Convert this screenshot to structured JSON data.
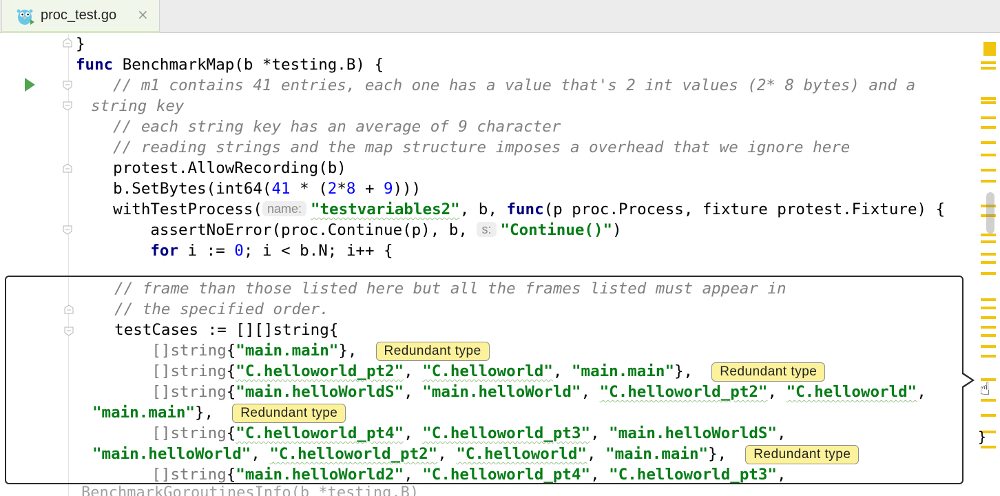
{
  "tab": {
    "title": "proc_test.go",
    "icon": "gopher-file-icon",
    "close": "×"
  },
  "editor": {
    "lines": [
      {
        "id": "l0",
        "segments": [
          {
            "t": "}",
            "c": ""
          }
        ]
      },
      {
        "id": "l1",
        "segments": [
          {
            "t": "func",
            "c": "kw"
          },
          {
            "t": " BenchmarkMap(b *testing.B) {",
            "c": ""
          }
        ]
      },
      {
        "id": "l2",
        "segments": [
          {
            "t": "    // m1 contains 41 entries, each one has a value that's 2 int values (2* 8 bytes) and a",
            "c": "cm"
          }
        ]
      },
      {
        "id": "l3",
        "segments": [
          {
            "t": "string key",
            "c": "cm"
          }
        ]
      },
      {
        "id": "l4",
        "segments": [
          {
            "t": "    // each string key has an average of 9 character",
            "c": "cm"
          }
        ]
      },
      {
        "id": "l5",
        "segments": [
          {
            "t": "    // reading strings and the map structure imposes a overhead that we ignore here",
            "c": "cm"
          }
        ]
      },
      {
        "id": "l6",
        "segments": [
          {
            "t": "    protest.AllowRecording(b)",
            "c": ""
          }
        ]
      },
      {
        "id": "l7",
        "segments": [
          {
            "t": "    b.SetBytes(int64(",
            "c": ""
          },
          {
            "t": "41",
            "c": "num"
          },
          {
            "t": " * (",
            "c": ""
          },
          {
            "t": "2",
            "c": "num"
          },
          {
            "t": "*",
            "c": ""
          },
          {
            "t": "8",
            "c": "num"
          },
          {
            "t": " + ",
            "c": ""
          },
          {
            "t": "9",
            "c": "num"
          },
          {
            "t": ")))",
            "c": ""
          }
        ]
      },
      {
        "id": "l8",
        "segments": [
          {
            "t": "    withTestProcess(",
            "c": ""
          },
          {
            "t": "name:",
            "c": "hint"
          },
          {
            "t": "\"testvariables2\"",
            "c": "str wavy"
          },
          {
            "t": ", b, ",
            "c": ""
          },
          {
            "t": "func",
            "c": "kw"
          },
          {
            "t": "(p proc.Process, fixture protest.Fixture) {",
            "c": ""
          }
        ]
      },
      {
        "id": "l9",
        "segments": [
          {
            "t": "        assertNoError(proc.Continue(p), b, ",
            "c": ""
          },
          {
            "t": "s:",
            "c": "hint"
          },
          {
            "t": "\"Continue()\"",
            "c": "str"
          },
          {
            "t": ")",
            "c": ""
          }
        ]
      },
      {
        "id": "l10",
        "segments": [
          {
            "t": "        ",
            "c": ""
          },
          {
            "t": "for",
            "c": "kw"
          },
          {
            "t": " i := ",
            "c": ""
          },
          {
            "t": "0",
            "c": "num"
          },
          {
            "t": "; i < b.N; i++ {",
            "c": ""
          }
        ]
      }
    ]
  },
  "popup": {
    "lines": [
      {
        "id": "p0",
        "segments": [
          {
            "t": "    // frame than those listed here but all the frames listed must appear in",
            "c": "cm"
          }
        ]
      },
      {
        "id": "p1",
        "segments": [
          {
            "t": "    // the specified order.",
            "c": "cm"
          }
        ]
      },
      {
        "id": "p2",
        "segments": [
          {
            "t": "    testCases := [][]string{",
            "c": ""
          }
        ]
      },
      {
        "id": "p3",
        "segments": [
          {
            "t": "        []string",
            "c": "ty"
          },
          {
            "t": "{",
            "c": ""
          },
          {
            "t": "\"main.main\"",
            "c": "str"
          },
          {
            "t": "},  ",
            "c": ""
          },
          {
            "t": "Redundant type",
            "c": "redundant"
          }
        ]
      },
      {
        "id": "p4",
        "segments": [
          {
            "t": "        []string",
            "c": "ty"
          },
          {
            "t": "{",
            "c": ""
          },
          {
            "t": "\"C.helloworld_pt2\"",
            "c": "str wavy"
          },
          {
            "t": ", ",
            "c": ""
          },
          {
            "t": "\"C.helloworld\"",
            "c": "str wavy"
          },
          {
            "t": ", ",
            "c": ""
          },
          {
            "t": "\"main.main\"",
            "c": "str"
          },
          {
            "t": "},  ",
            "c": ""
          },
          {
            "t": "Redundant type",
            "c": "redundant"
          }
        ]
      },
      {
        "id": "p5",
        "segments": [
          {
            "t": "        []string",
            "c": "ty"
          },
          {
            "t": "{",
            "c": ""
          },
          {
            "t": "\"main.helloWorldS\"",
            "c": "str"
          },
          {
            "t": ", ",
            "c": ""
          },
          {
            "t": "\"main.helloWorld\"",
            "c": "str"
          },
          {
            "t": ", ",
            "c": ""
          },
          {
            "t": "\"C.helloworld_pt2\"",
            "c": "str wavy"
          },
          {
            "t": ", ",
            "c": ""
          },
          {
            "t": "\"C.helloworld\"",
            "c": "str wavy"
          },
          {
            "t": ",",
            "c": ""
          }
        ]
      },
      {
        "id": "p6",
        "segments": [
          {
            "t": "\"main.main\"",
            "c": "str"
          },
          {
            "t": "},  ",
            "c": ""
          },
          {
            "t": "Redundant type",
            "c": "redundant"
          }
        ]
      },
      {
        "id": "p7",
        "segments": [
          {
            "t": "        []string",
            "c": "ty"
          },
          {
            "t": "{",
            "c": ""
          },
          {
            "t": "\"C.helloworld_pt4\"",
            "c": "str wavy"
          },
          {
            "t": ", ",
            "c": ""
          },
          {
            "t": "\"C.helloworld_pt3\"",
            "c": "str wavy"
          },
          {
            "t": ", ",
            "c": ""
          },
          {
            "t": "\"main.helloWorldS\"",
            "c": "str"
          },
          {
            "t": ",",
            "c": ""
          }
        ]
      },
      {
        "id": "p8",
        "segments": [
          {
            "t": "\"main.helloWorld\"",
            "c": "str"
          },
          {
            "t": ", ",
            "c": ""
          },
          {
            "t": "\"C.helloworld_pt2\"",
            "c": "str wavy"
          },
          {
            "t": ", ",
            "c": ""
          },
          {
            "t": "\"C.helloworld\"",
            "c": "str wavy"
          },
          {
            "t": ", ",
            "c": ""
          },
          {
            "t": "\"main.main\"",
            "c": "str"
          },
          {
            "t": "},  ",
            "c": ""
          },
          {
            "t": "Redundant type",
            "c": "redundant"
          }
        ]
      },
      {
        "id": "p9",
        "segments": [
          {
            "t": "        []string",
            "c": "ty"
          },
          {
            "t": "{",
            "c": ""
          },
          {
            "t": "\"main.helloWorld2\"",
            "c": "str"
          },
          {
            "t": ", ",
            "c": ""
          },
          {
            "t": "\"C.helloworld_pt4\"",
            "c": "str wavy"
          },
          {
            "t": ", ",
            "c": ""
          },
          {
            "t": "\"C.helloworld_pt3\"",
            "c": "str wavy"
          },
          {
            "t": ",",
            "c": ""
          }
        ]
      }
    ]
  },
  "below": {
    "text": "BenchmarkGoroutinesInfo(b *testing.B)"
  },
  "stripe": {
    "cursor": "☝",
    "brace": "}"
  },
  "colors": {
    "keyword": "#000080",
    "string": "#067d17",
    "comment": "#808080",
    "number": "#0000ff",
    "warning": "#f1c40f"
  }
}
